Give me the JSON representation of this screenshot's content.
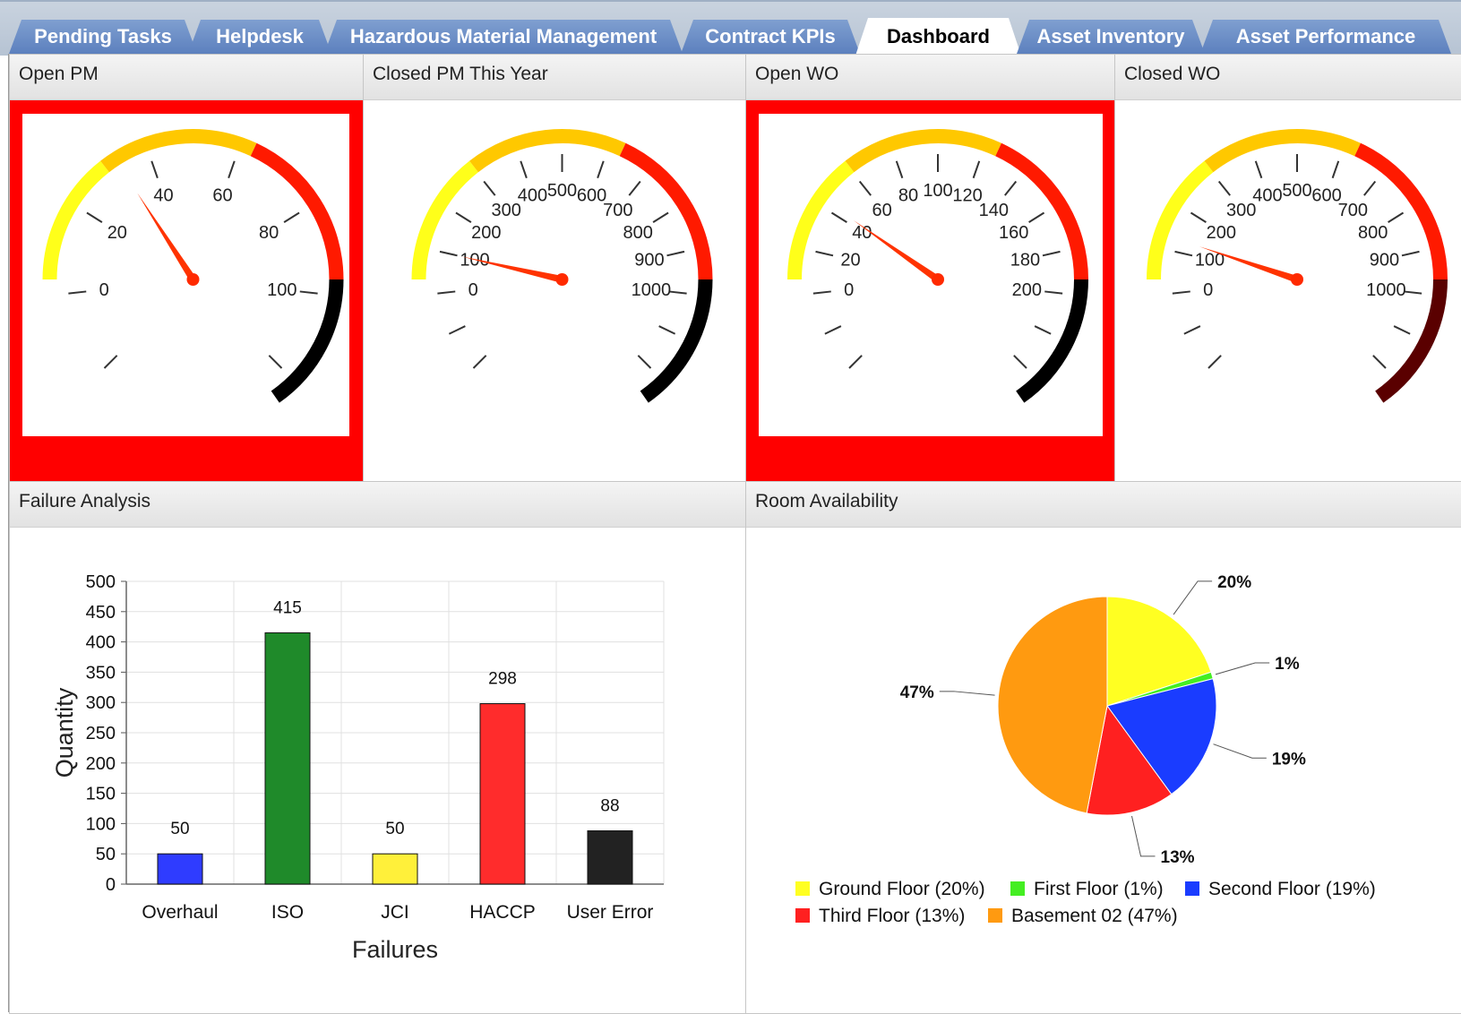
{
  "tabs": [
    {
      "label": "Pending Tasks",
      "active": false
    },
    {
      "label": "Helpdesk",
      "active": false
    },
    {
      "label": "Hazardous Material Management",
      "active": false
    },
    {
      "label": "Contract KPIs",
      "active": false
    },
    {
      "label": "Dashboard",
      "active": true
    },
    {
      "label": "Asset Inventory",
      "active": false
    },
    {
      "label": "Asset Performance",
      "active": false
    }
  ],
  "gauges": [
    {
      "title": "Open PM",
      "alert": true,
      "min": -20,
      "max": 120,
      "value": 33,
      "labels": [
        0,
        20,
        40,
        60,
        80,
        100
      ],
      "band_end_color": "#000000"
    },
    {
      "title": "Closed PM This Year",
      "alert": false,
      "min": -200,
      "max": 1200,
      "value": 100,
      "labels": [
        0,
        100,
        200,
        300,
        400,
        500,
        600,
        700,
        800,
        900,
        1000
      ],
      "band_end_color": "#000000"
    },
    {
      "title": "Open WO",
      "alert": true,
      "min": -40,
      "max": 240,
      "value": 43,
      "labels": [
        0,
        20,
        40,
        60,
        80,
        100,
        120,
        140,
        160,
        180,
        200
      ],
      "band_end_color": "#000000"
    },
    {
      "title": "Closed WO",
      "alert": false,
      "min": -200,
      "max": 1200,
      "value": 130,
      "labels": [
        0,
        100,
        200,
        300,
        400,
        500,
        600,
        700,
        800,
        900,
        1000
      ],
      "band_end_color": "#5a0000"
    }
  ],
  "failure_panel": {
    "title": "Failure Analysis"
  },
  "room_panel": {
    "title": "Room Availability"
  },
  "chart_data": [
    {
      "type": "bar",
      "title": "Failure Analysis",
      "xlabel": "Failures",
      "ylabel": "Quantity",
      "categories": [
        "Overhaul",
        "ISO",
        "JCI",
        "HACCP",
        "User Error"
      ],
      "values": [
        50,
        415,
        50,
        298,
        88
      ],
      "colors": [
        "#2f3cff",
        "#1f8a2a",
        "#fff03a",
        "#ff2c2c",
        "#222222"
      ],
      "ylim": [
        0,
        500
      ],
      "yticks": [
        0,
        50,
        100,
        150,
        200,
        250,
        300,
        350,
        400,
        450,
        500
      ],
      "grid": true
    },
    {
      "type": "pie",
      "title": "Room Availability",
      "slices": [
        {
          "label": "Ground Floor",
          "percent": 20,
          "color": "#ffff22",
          "legend": "Ground Floor (20%)",
          "callout": "20%"
        },
        {
          "label": "First Floor",
          "percent": 1,
          "color": "#44ee22",
          "legend": "First Floor (1%)",
          "callout": "1%"
        },
        {
          "label": "Second Floor",
          "percent": 19,
          "color": "#1a3cff",
          "legend": "Second Floor (19%)",
          "callout": "19%"
        },
        {
          "label": "Third Floor",
          "percent": 13,
          "color": "#ff2020",
          "legend": "Third Floor (13%)",
          "callout": "13%"
        },
        {
          "label": "Basement 02",
          "percent": 47,
          "color": "#ff9a10",
          "legend": "Basement 02 (47%)",
          "callout": "47%"
        }
      ],
      "legend_position": "bottom"
    }
  ]
}
